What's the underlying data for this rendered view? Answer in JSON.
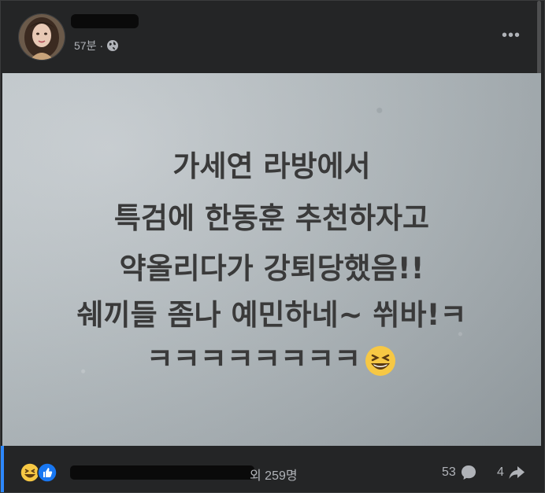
{
  "post": {
    "author_name": "████",
    "time": "57분",
    "separator": "·",
    "privacy_icon": "globe-icon",
    "more_icon": "more-horizontal-icon",
    "more_label": "•••"
  },
  "image": {
    "lines": [
      "가세연 라방에서",
      "특검에 한동훈 추천하자고",
      "약올리다가 강퇴당했음!!",
      "쉐끼들 좀나 예민하네~ 쒸바!ㅋ",
      "ㅋㅋㅋㅋㅋㅋㅋㅋ"
    ],
    "emoji": "laughing-emoji",
    "background_color": "#b6bdc1",
    "text_color": "#3a3a3a"
  },
  "footer": {
    "reaction_icons": [
      "haha-icon",
      "like-icon"
    ],
    "reactors_redacted": "████████████",
    "reactors_suffix": "외 259명",
    "comments_count": "53",
    "comments_icon": "comment-icon",
    "shares_count": "4",
    "shares_icon": "share-icon",
    "accent_color": "#2d88ff"
  }
}
